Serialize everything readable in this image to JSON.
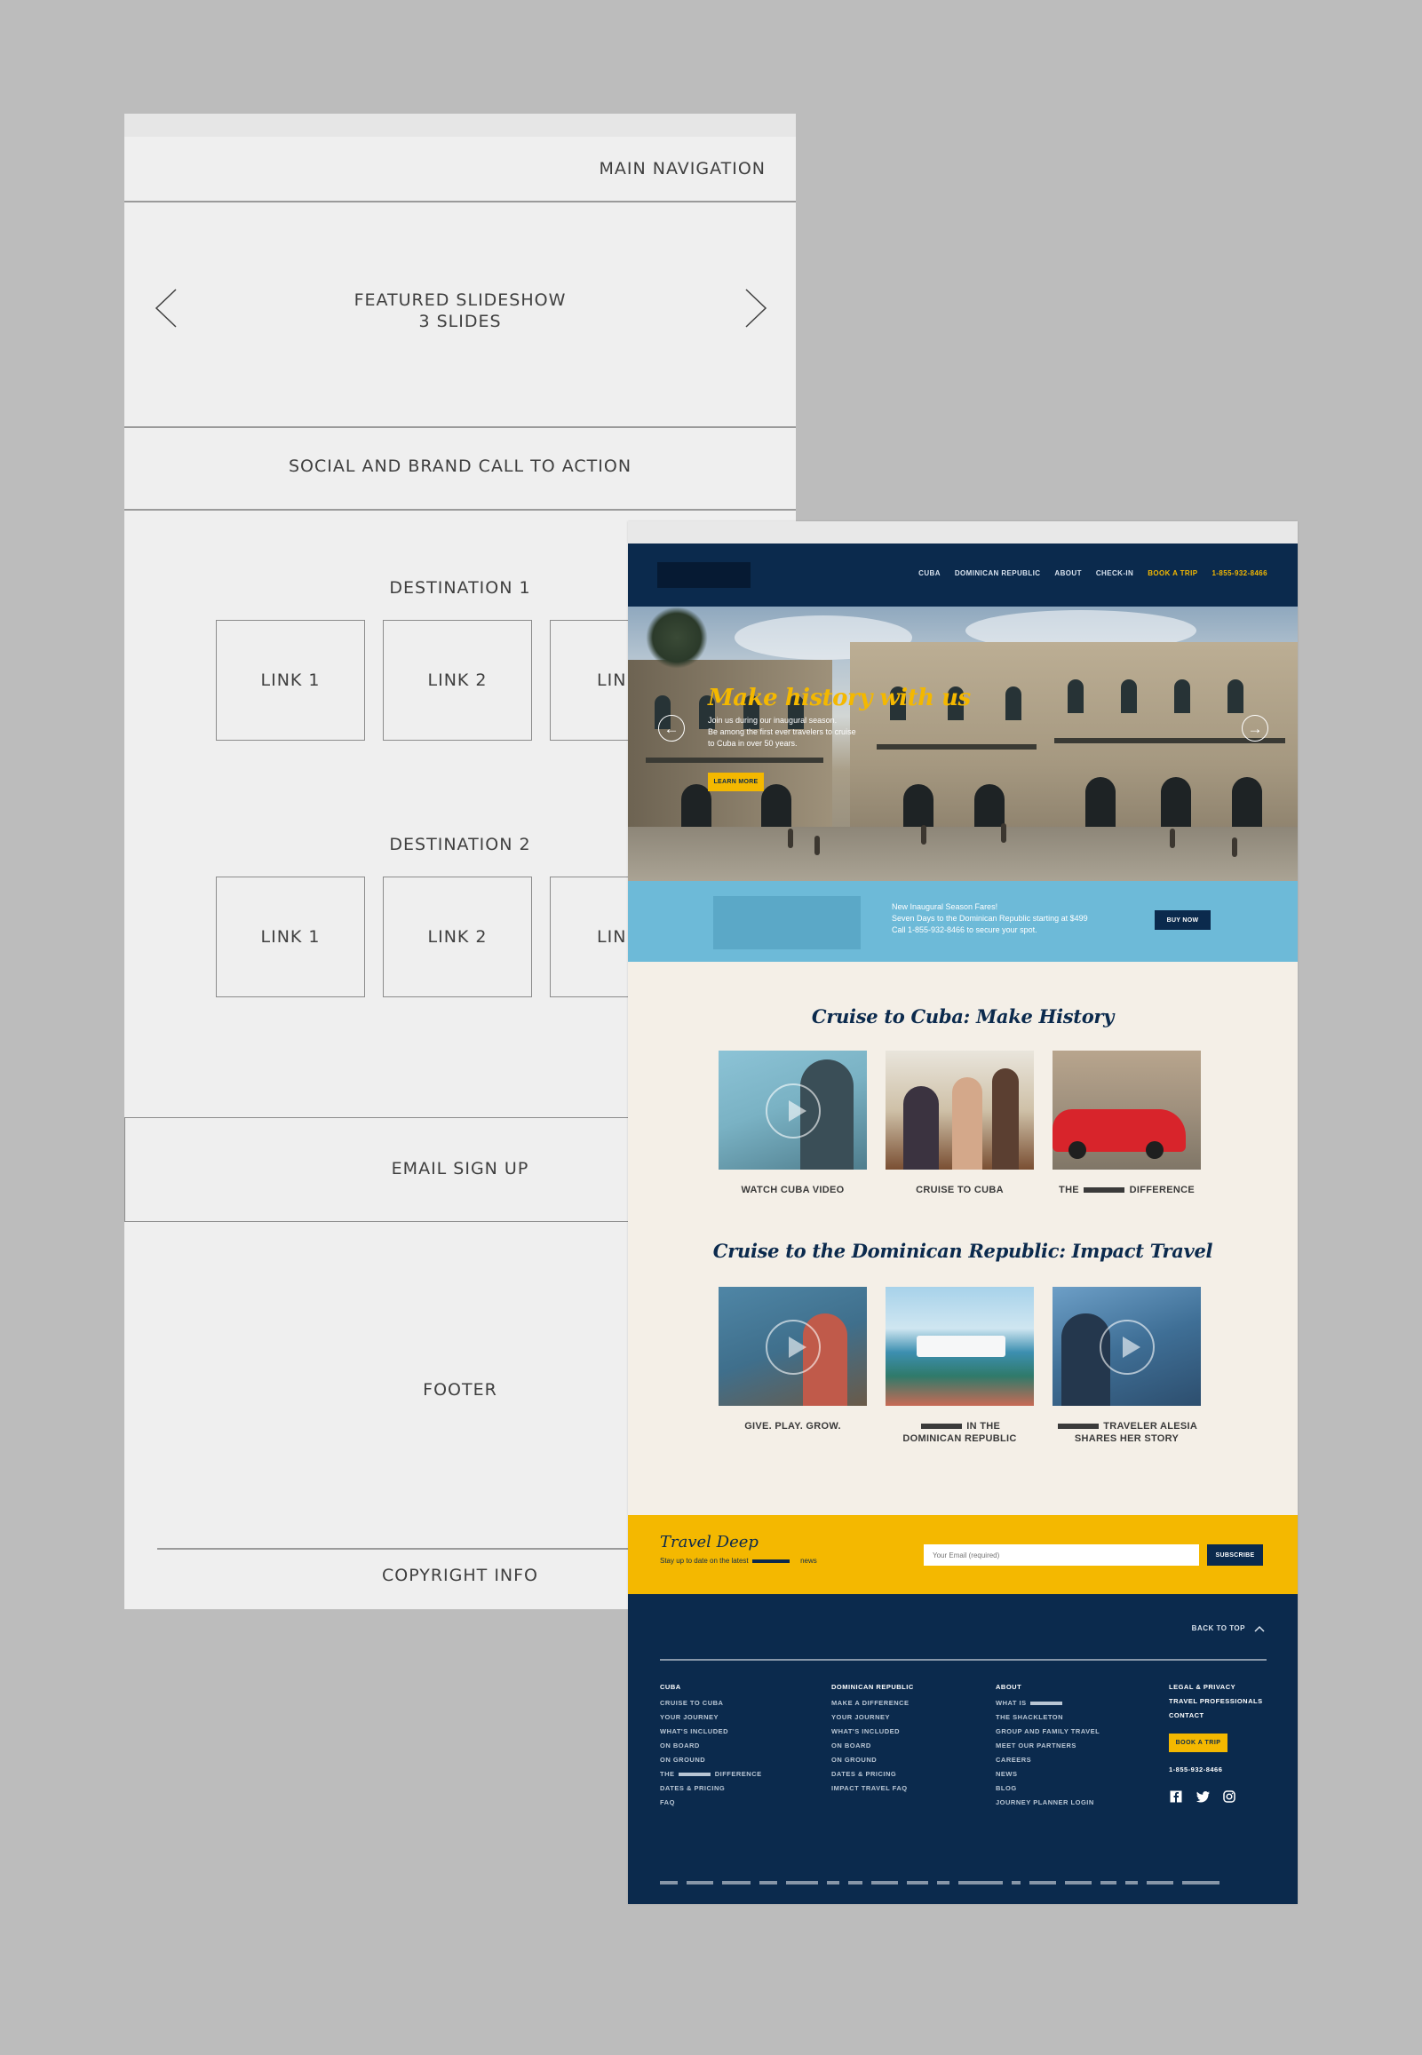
{
  "wireframe": {
    "main_navigation": "MAIN NAVIGATION",
    "slideshow_line1": "FEATURED SLIDESHOW",
    "slideshow_line2": "3 SLIDES",
    "social_cta": "SOCIAL AND BRAND CALL TO ACTION",
    "destination1": {
      "title": "DESTINATION 1",
      "links": [
        "LINK 1",
        "LINK 2",
        "LIN"
      ]
    },
    "destination2": {
      "title": "DESTINATION 2",
      "links": [
        "LINK 1",
        "LINK 2",
        "LIN"
      ]
    },
    "email_signup": "EMAIL SIGN UP",
    "footer": "FOOTER",
    "copyright": "COPYRIGHT INFO"
  },
  "mockup": {
    "nav": [
      "CUBA",
      "DOMINICAN REPUBLIC",
      "ABOUT",
      "CHECK-IN",
      "BOOK A TRIP",
      "1-855-932-8466"
    ],
    "hero": {
      "title": "Make history with us",
      "sub_line1": "Join us during our inaugural season.",
      "sub_line2": "Be among the first ever travelers to cruise",
      "sub_line3": "to Cuba in over 50 years.",
      "button": "LEARN MORE"
    },
    "promo": {
      "line1": "New Inaugural Season Fares!",
      "line2": "Seven Days to the Dominican Republic starting at $499",
      "line3": "Call 1-855-932-8466 to secure your spot.",
      "button": "BUY NOW"
    },
    "section1": {
      "title": "Cruise to Cuba: Make History",
      "cards": [
        "WATCH CUBA VIDEO",
        "CRUISE TO CUBA",
        "THE",
        "DIFFERENCE"
      ]
    },
    "section2": {
      "title": "Cruise to the Dominican Republic: Impact Travel",
      "card1": "GIVE. PLAY. GROW.",
      "card2_a": "IN THE",
      "card2_b": "DOMINICAN REPUBLIC",
      "card3_a": "TRAVELER ALESIA",
      "card3_b": "SHARES HER STORY"
    },
    "newsletter": {
      "title": "Travel Deep",
      "sub_before": "Stay up to date on the latest",
      "sub_after": "news",
      "placeholder": "Your Email (required)",
      "button": "SUBSCRIBE"
    },
    "footer": {
      "back_to_top": "BACK TO TOP",
      "cuba": {
        "heading": "CUBA",
        "items": [
          "CRUISE TO CUBA",
          "YOUR JOURNEY",
          "WHAT'S INCLUDED",
          "ON BOARD",
          "ON GROUND",
          "THE",
          "DIFFERENCE",
          "DATES & PRICING",
          "FAQ"
        ]
      },
      "dr": {
        "heading": "DOMINICAN REPUBLIC",
        "items": [
          "MAKE A DIFFERENCE",
          "YOUR JOURNEY",
          "WHAT'S INCLUDED",
          "ON BOARD",
          "ON GROUND",
          "DATES & PRICING",
          "IMPACT TRAVEL FAQ"
        ]
      },
      "about": {
        "heading": "ABOUT",
        "items": [
          "WHAT IS",
          "THE SHACKLETON",
          "GROUP AND FAMILY TRAVEL",
          "MEET OUR PARTNERS",
          "CAREERS",
          "NEWS",
          "BLOG",
          "JOURNEY PLANNER LOGIN"
        ]
      },
      "legal": {
        "items": [
          "LEGAL & PRIVACY",
          "TRAVEL PROFESSIONALS",
          "CONTACT"
        ],
        "book": "BOOK A TRIP",
        "phone": "1-855-932-8466"
      },
      "social_icons": [
        "facebook-icon",
        "twitter-icon",
        "instagram-icon"
      ]
    }
  }
}
